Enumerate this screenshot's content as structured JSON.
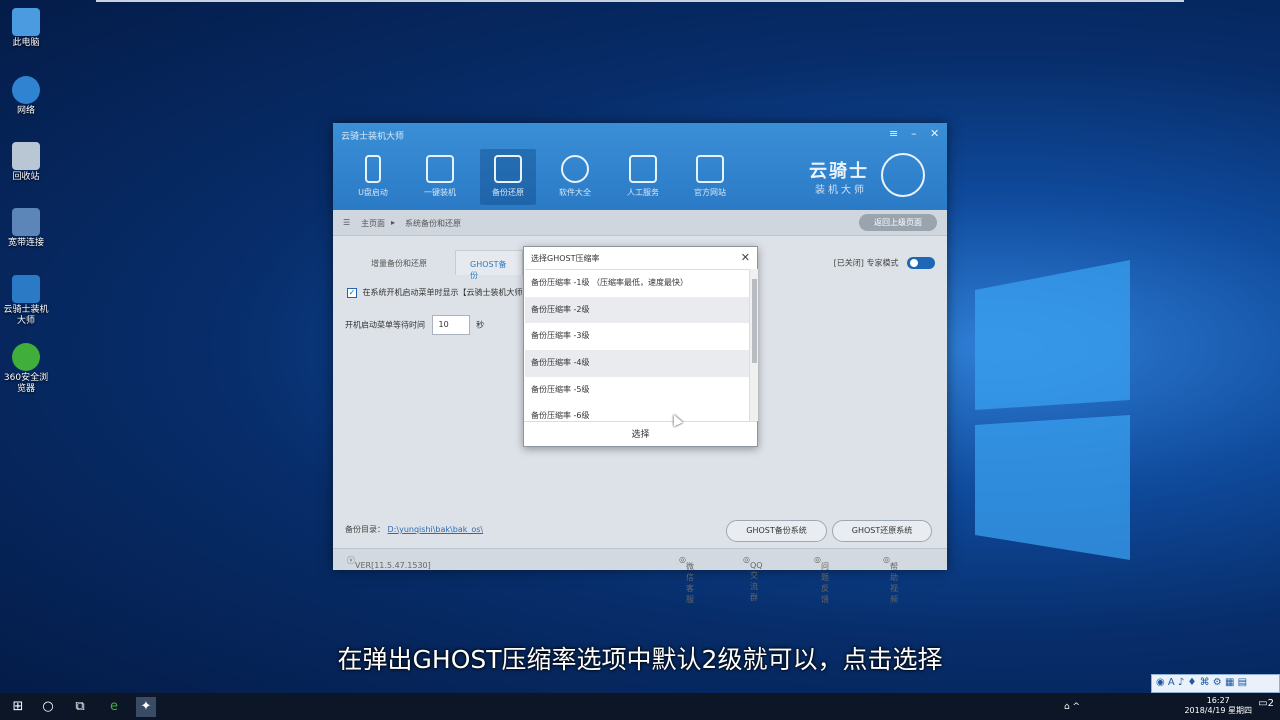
{
  "desktop": {
    "icons": [
      {
        "name": "此电脑"
      },
      {
        "name": "网络"
      },
      {
        "name": "回收站"
      },
      {
        "name": "宽带连接"
      },
      {
        "name": "云骑士装机大师"
      },
      {
        "name": "360安全浏览器"
      }
    ]
  },
  "app": {
    "title": "云骑士装机大师",
    "nav": [
      {
        "label": "U盘启动"
      },
      {
        "label": "一键装机"
      },
      {
        "label": "备份还原"
      },
      {
        "label": "软件大全"
      },
      {
        "label": "人工服务"
      },
      {
        "label": "官方网站"
      }
    ],
    "brand": {
      "title": "云骑士",
      "subtitle": "装机大师"
    },
    "breadcrumb": {
      "home": "主页面",
      "current": "系统备份和还原"
    },
    "back_label": "返回上级页面",
    "tabs": [
      {
        "label": "增量备份和还原"
      },
      {
        "label": "GHOST备份"
      }
    ],
    "mode_label": "[已关闭] 专家模式",
    "option_boot": "在系统开机启动菜单时显示【云骑士装机大师",
    "option_wait_prefix": "开机启动菜单等待时间",
    "option_wait_value": "10",
    "option_wait_unit": "秒",
    "backup_dir_label": "备份目录：",
    "backup_dir_path": "D:\\yunqishi\\bak\\bak_os\\",
    "btn_backup": "GHOST备份系统",
    "btn_restore": "GHOST还原系统",
    "version": "VER[11.5.47.1530]",
    "status_links": [
      "微信客服",
      "QQ交流群",
      "问题反馈",
      "帮助视频"
    ]
  },
  "dialog": {
    "title": "选择GHOST压缩率",
    "items": [
      "备份压缩率 -1级 （压缩率最低，速度最快）",
      "备份压缩率 -2级",
      "备份压缩率 -3级",
      "备份压缩率 -4级",
      "备份压缩率 -5级",
      "备份压缩率 -6级"
    ],
    "confirm": "选择"
  },
  "subtitle": "在弹出GHOST压缩率选项中默认2级就可以，点击选择",
  "taskbar": {
    "time": "16:27",
    "date": "2018/4/19 星期四",
    "notif_count": "2"
  },
  "colors": {
    "accent": "#2b7ac6",
    "desktop": "#0a3f8c"
  }
}
